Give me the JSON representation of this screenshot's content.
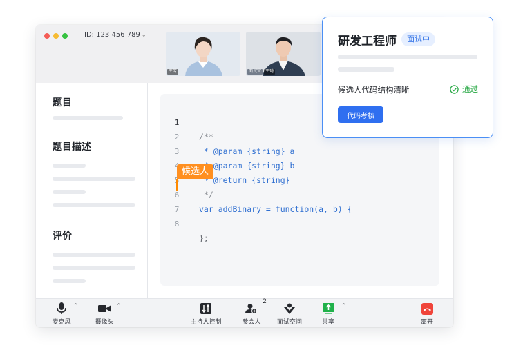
{
  "window": {
    "meeting_id": "ID: 123 456 789"
  },
  "videos": [
    {
      "name": "王芳"
    },
    {
      "role": "面试官",
      "name": "王琦"
    }
  ],
  "sidebar": {
    "question_title": "题目",
    "question_desc_title": "题目描述",
    "evaluation_title": "评价"
  },
  "editor": {
    "lines": [
      {
        "no": "1",
        "text": "/**"
      },
      {
        "no": "2",
        "text": " * @param {string} a"
      },
      {
        "no": "3",
        "text": " * @param {string} b"
      },
      {
        "no": "4",
        "text": " * @return {string}"
      },
      {
        "no": "5",
        "text": " */"
      },
      {
        "no": "6",
        "text": "var addBinary = function(a, b) {"
      },
      {
        "no": "7",
        "text": ""
      },
      {
        "no": "8",
        "text": "};"
      }
    ],
    "cursor_label": "候选人"
  },
  "toolbar": {
    "mic": "麦克风",
    "camera": "摄像头",
    "host_control": "主持人控制",
    "participants": "参会人",
    "participants_count": "2",
    "interview_space": "面试空间",
    "share": "共享",
    "leave": "离开"
  },
  "card": {
    "title": "研发工程师",
    "status": "面试中",
    "note": "候选人代码结构清晰",
    "result": "通过",
    "button": "代码考核"
  },
  "colors": {
    "accent": "#2f6ff0",
    "candidate_cursor": "#ff8f1f",
    "pass": "#27a844",
    "leave": "#f0443a",
    "share": "#20b14a"
  }
}
